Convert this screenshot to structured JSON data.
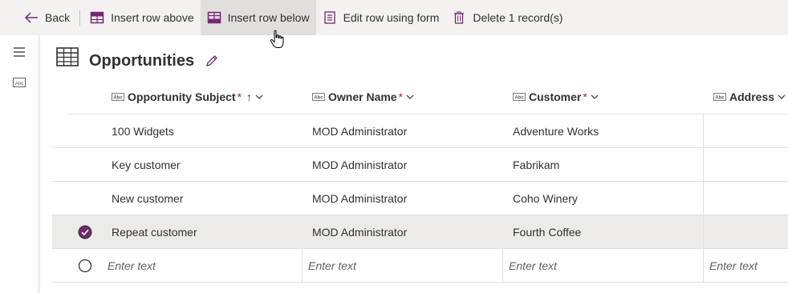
{
  "toolbar": {
    "back_label": "Back",
    "insert_above_label": "Insert row above",
    "insert_below_label": "Insert row below",
    "edit_form_label": "Edit row using form",
    "delete_label": "Delete 1 record(s)",
    "icons": [
      "back-arrow-icon",
      "insert-row-above-icon",
      "insert-row-below-icon",
      "form-icon",
      "trash-icon"
    ]
  },
  "rail": {
    "icons": [
      "hamburger-menu-icon",
      "text-field-icon"
    ]
  },
  "page": {
    "title": "Opportunities"
  },
  "table": {
    "columns": [
      {
        "label": "Opportunity Subject",
        "required": "*",
        "sorted": "↑"
      },
      {
        "label": "Owner Name",
        "required": "*"
      },
      {
        "label": "Customer",
        "required": "*"
      },
      {
        "label": "Address"
      }
    ],
    "rows": [
      {
        "subject": "100 Widgets",
        "owner": "MOD Administrator",
        "customer": "Adventure Works",
        "selected": false
      },
      {
        "subject": "Key customer",
        "owner": "MOD Administrator",
        "customer": "Fabrikam",
        "selected": false
      },
      {
        "subject": "New customer",
        "owner": "MOD Administrator",
        "customer": "Coho Winery",
        "selected": false
      },
      {
        "subject": "Repeat customer",
        "owner": "MOD Administrator",
        "customer": "Fourth Coffee",
        "selected": true
      }
    ],
    "new_row_placeholder": "Enter text"
  },
  "colors": {
    "accent": "#742774",
    "toolbar_bg": "#f3f2f1",
    "selected_row": "#edebe9",
    "required": "#a4262c"
  }
}
